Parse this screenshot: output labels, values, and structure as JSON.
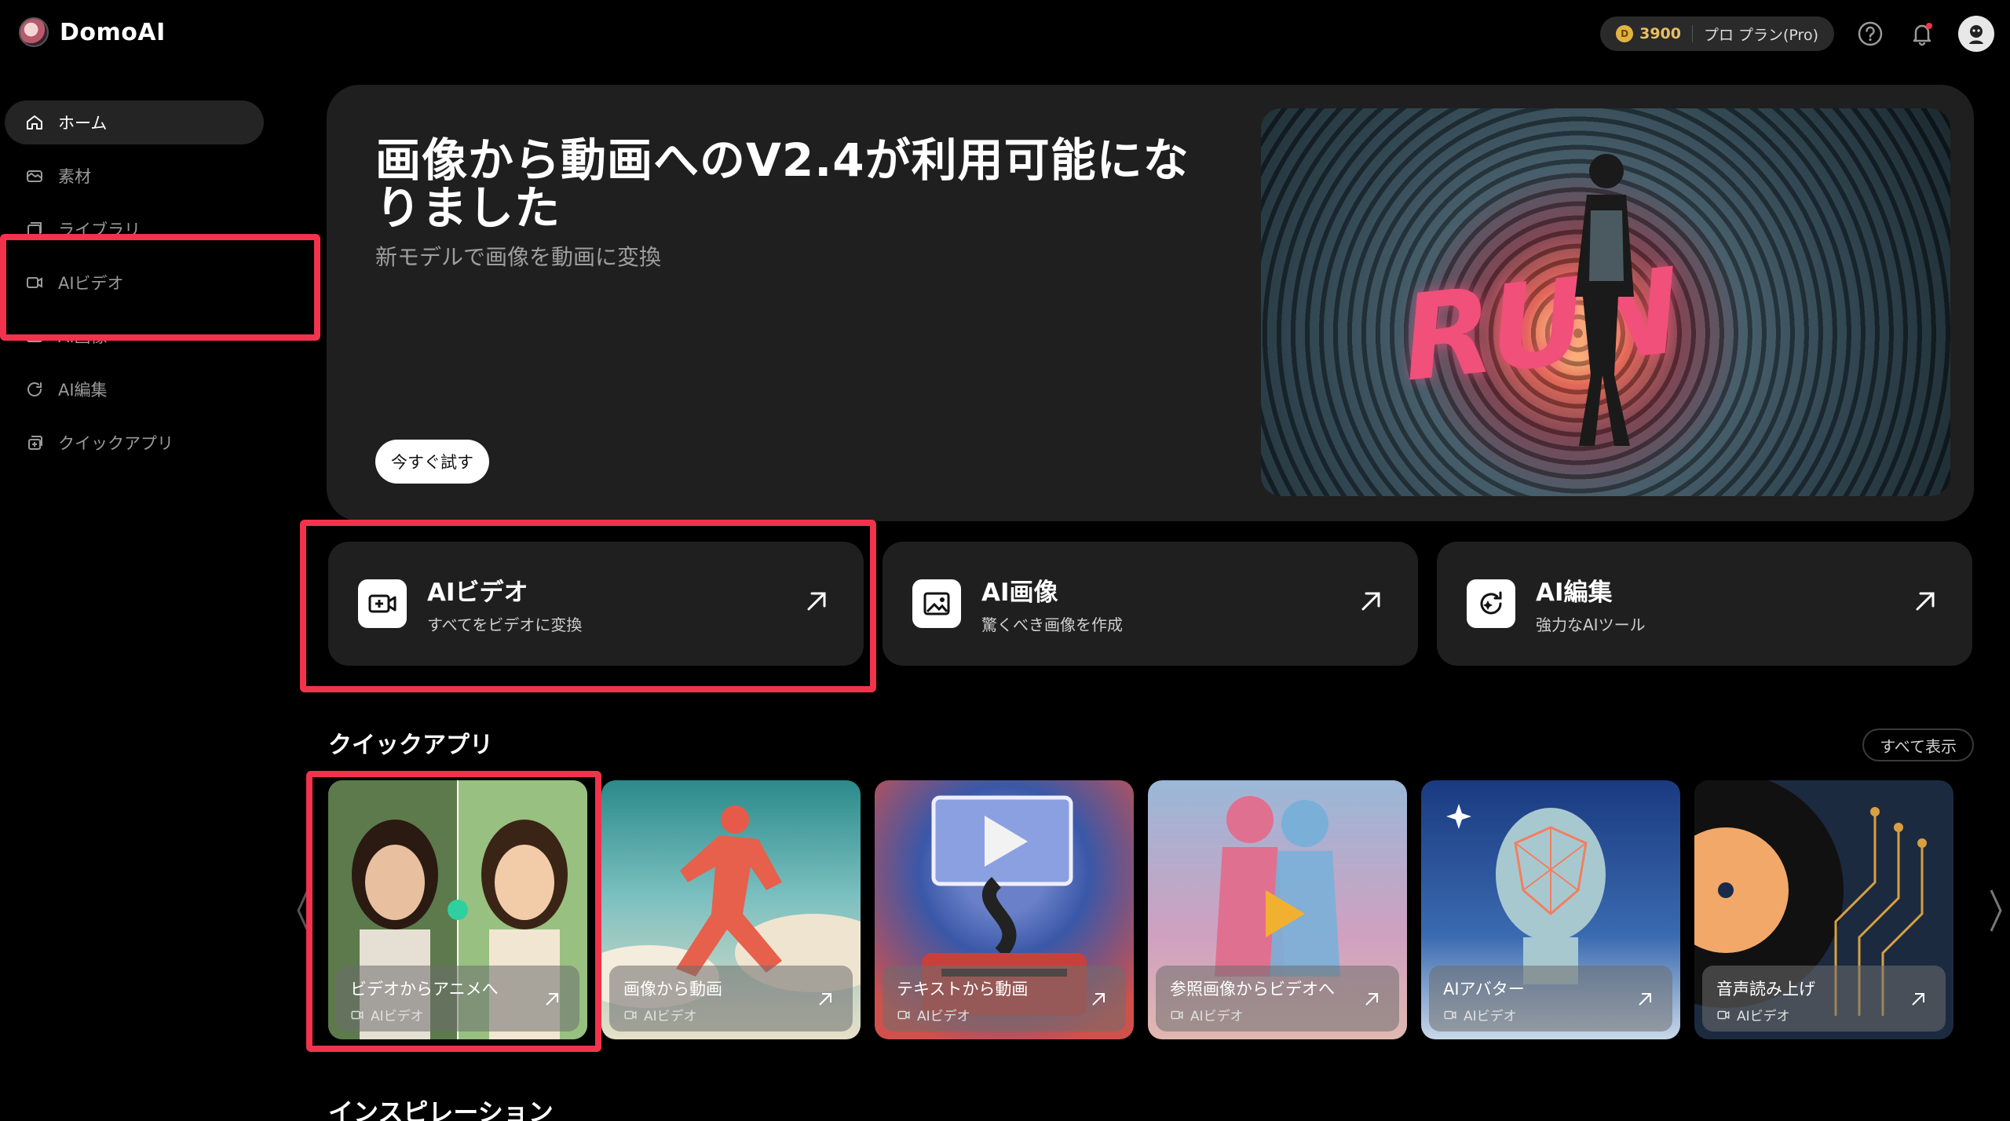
{
  "app": {
    "name": "DomoAI"
  },
  "header": {
    "credits": "3900",
    "plan": "プロ プラン(Pro)"
  },
  "sidebar": {
    "items": [
      {
        "label": "ホーム",
        "icon": "home-icon",
        "active": true
      },
      {
        "label": "素材",
        "icon": "asset-icon",
        "active": false
      },
      {
        "label": "ライブラリ",
        "icon": "library-icon",
        "active": false
      },
      {
        "label": "AIビデオ",
        "icon": "video-icon",
        "active": false
      },
      {
        "label": "AI画像",
        "icon": "image-icon",
        "active": false
      },
      {
        "label": "AI編集",
        "icon": "edit-icon",
        "active": false
      },
      {
        "label": "クイックアプリ",
        "icon": "apps-icon",
        "active": false
      }
    ]
  },
  "hero": {
    "title": "画像から動画へのV2.4が利用可能になりました",
    "subtitle": "新モデルで画像を動画に変換",
    "button": "今すぐ試す",
    "art_text": "RUN"
  },
  "features": [
    {
      "title": "AIビデオ",
      "subtitle": "すべてをビデオに変換",
      "icon": "video-icon"
    },
    {
      "title": "AI画像",
      "subtitle": "驚くべき画像を作成",
      "icon": "image-icon"
    },
    {
      "title": "AI編集",
      "subtitle": "強力なAIツール",
      "icon": "edit-icon"
    }
  ],
  "quick_apps": {
    "title": "クイックアプリ",
    "show_all": "すべて表示",
    "items": [
      {
        "name": "ビデオからアニメへ",
        "category": "AIビデオ"
      },
      {
        "name": "画像から動画",
        "category": "AIビデオ"
      },
      {
        "name": "テキストから動画",
        "category": "AIビデオ"
      },
      {
        "name": "参照画像からビデオへ",
        "category": "AIビデオ"
      },
      {
        "name": "AIアバター",
        "category": "AIビデオ"
      },
      {
        "name": "音声読み上げ",
        "category": "AIビデオ"
      }
    ]
  },
  "inspiration": {
    "title": "インスピレーション"
  },
  "colors": {
    "highlight": "#f2334b",
    "accent_coin": "#e3b341"
  }
}
